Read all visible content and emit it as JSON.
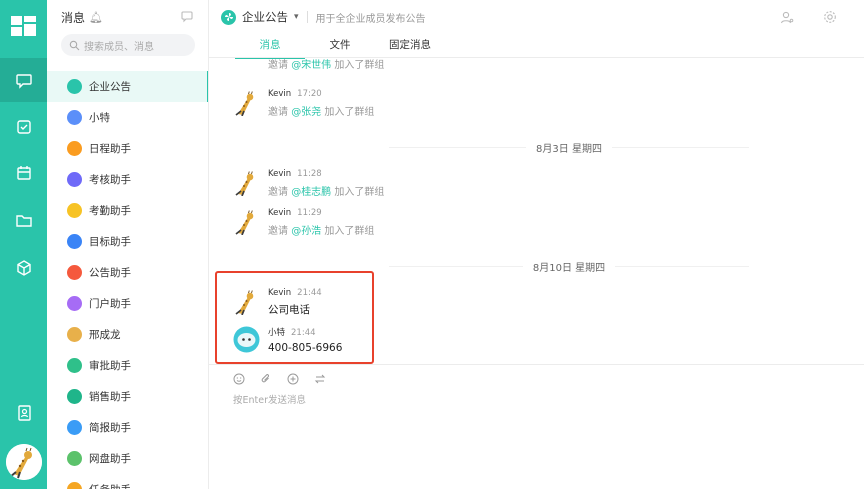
{
  "rail": {
    "items": [
      {
        "icon": "chat-icon",
        "active": true
      },
      {
        "icon": "checkbox-icon",
        "active": false
      },
      {
        "icon": "calendar-icon",
        "active": false
      },
      {
        "icon": "folder-icon",
        "active": false
      },
      {
        "icon": "cube-icon",
        "active": false
      },
      {
        "icon": "contacts-icon",
        "active": false
      }
    ]
  },
  "sessions": {
    "title": "消息",
    "search_placeholder": "搜索成员、消息",
    "items": [
      {
        "label": "企业公告",
        "color": "#2ac4aa",
        "active": true
      },
      {
        "label": "小特",
        "color": "#5b8ff9",
        "active": false
      },
      {
        "label": "日程助手",
        "color": "#fa9c20",
        "active": false
      },
      {
        "label": "考核助手",
        "color": "#6f6af8",
        "active": false
      },
      {
        "label": "考勤助手",
        "color": "#f7c325",
        "active": false
      },
      {
        "label": "目标助手",
        "color": "#3a84f6",
        "active": false
      },
      {
        "label": "公告助手",
        "color": "#f5593d",
        "active": false
      },
      {
        "label": "门户助手",
        "color": "#a66cf5",
        "active": false
      },
      {
        "label": "邢成龙",
        "color": "#e8b04a",
        "active": false
      },
      {
        "label": "审批助手",
        "color": "#2fc08a",
        "active": false
      },
      {
        "label": "销售助手",
        "color": "#1fb58a",
        "active": false
      },
      {
        "label": "简报助手",
        "color": "#3a9cf6",
        "active": false
      },
      {
        "label": "网盘助手",
        "color": "#5cc26b",
        "active": false
      },
      {
        "label": "任务助手",
        "color": "#f5a623",
        "active": false
      }
    ]
  },
  "header": {
    "title": "企业公告",
    "description": "用于全企业成员发布公告",
    "tabs": [
      "消息",
      "文件",
      "固定消息"
    ],
    "active_tab": 0
  },
  "chat": {
    "messages": [
      {
        "sender": "",
        "time": "",
        "prefix": "邀请 ",
        "mention": "@宋世伟",
        "suffix": " 加入了群组"
      },
      {
        "sender": "Kevin",
        "time": "17:20",
        "prefix": "邀请 ",
        "mention": "@张尧",
        "suffix": " 加入了群组"
      },
      {
        "sender": "Kevin",
        "time": "11:28",
        "prefix": "邀请 ",
        "mention": "@桂志鹏",
        "suffix": " 加入了群组"
      },
      {
        "sender": "Kevin",
        "time": "11:29",
        "prefix": "邀请 ",
        "mention": "@孙浩",
        "suffix": " 加入了群组"
      },
      {
        "sender": "Kevin",
        "time": "21:44",
        "text": "公司电话"
      },
      {
        "sender": "小特",
        "time": "21:44",
        "text": "400-805-6966"
      }
    ],
    "dividers": [
      "8月3日 星期四",
      "8月10日 星期四"
    ]
  },
  "composer": {
    "placeholder": "按Enter发送消息",
    "tools": [
      "emoji-icon",
      "attach-icon",
      "plus-icon",
      "switch-icon"
    ]
  },
  "colors": {
    "accent": "#2ac4aa",
    "highlight": "#e8412c"
  }
}
